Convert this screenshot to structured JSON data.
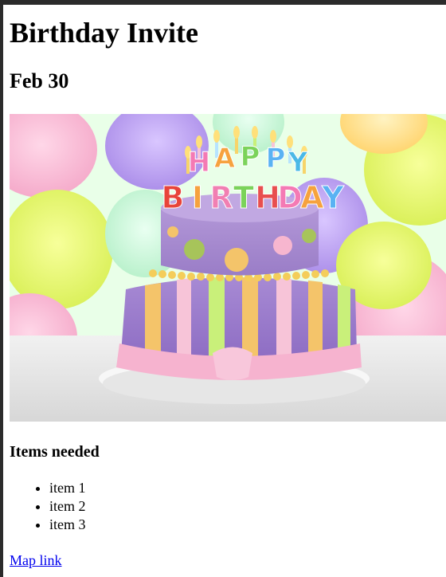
{
  "page": {
    "title": "Birthday Invite",
    "date": "Feb 30",
    "image": {
      "alt": "Happy Birthday cake",
      "cake_topper": [
        "H",
        "A",
        "P",
        "P",
        "Y",
        "B",
        "I",
        "R",
        "T",
        "H",
        "D",
        "A",
        "Y"
      ]
    },
    "items_heading": "Items needed",
    "items": [
      "item 1",
      "item 2",
      "item 3"
    ],
    "map_link": "Map link"
  }
}
